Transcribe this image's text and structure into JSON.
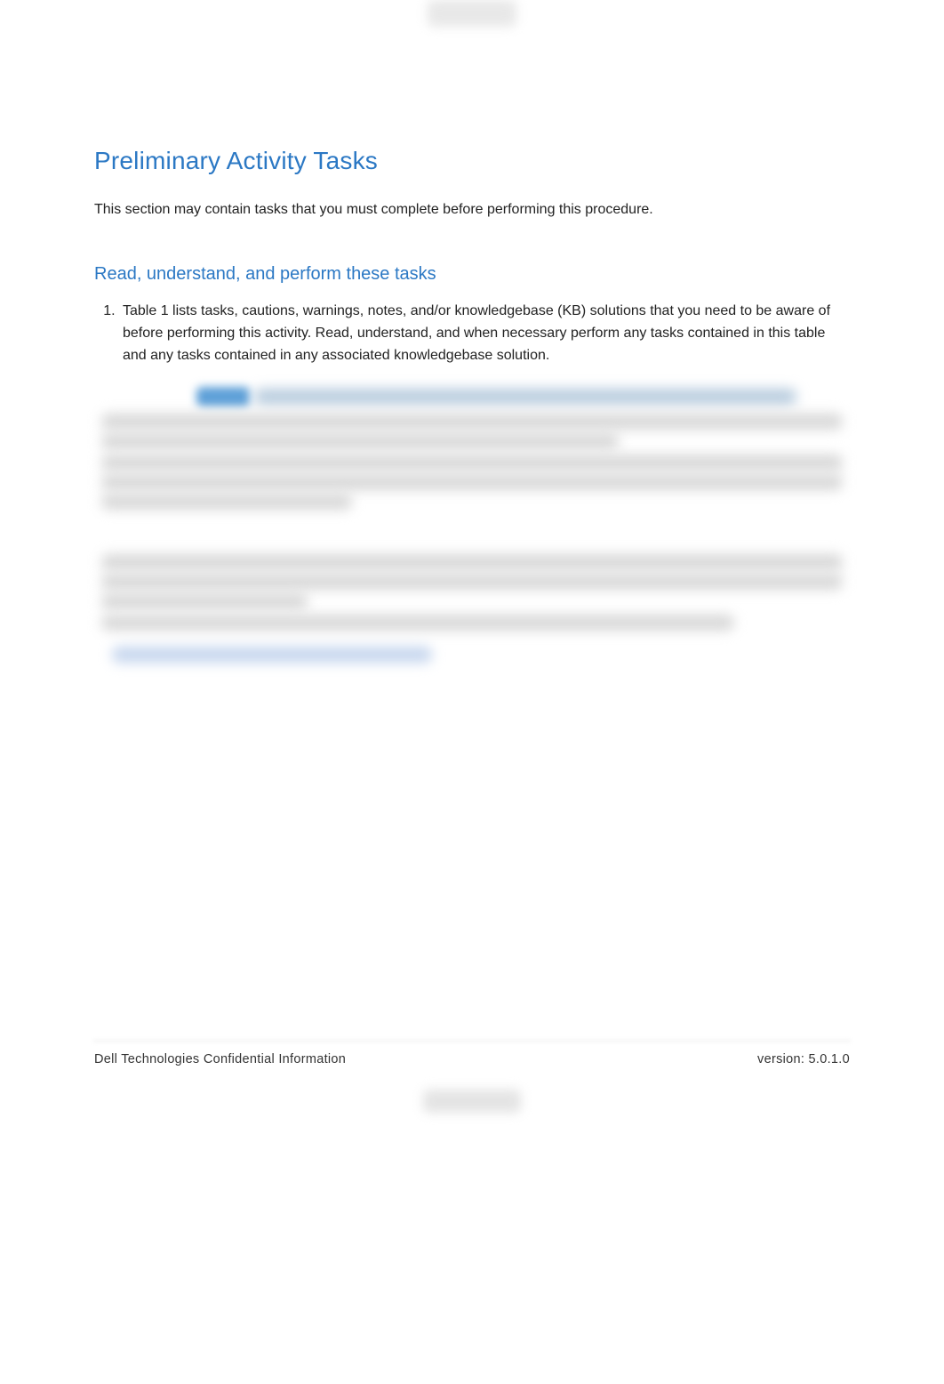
{
  "section": {
    "title": "Preliminary Activity Tasks",
    "intro": "This section may contain tasks that you must complete before performing this procedure.",
    "subsection_title": "Read, understand, and perform these tasks",
    "list_item_1": "Table 1 lists tasks, cautions, warnings, notes, and/or knowledgebase (KB) solutions that you need to be aware of before performing this activity.  Read, understand, and when necessary perform any tasks contained in this table and any tasks contained in any associated knowledgebase solution."
  },
  "footer": {
    "left": "Dell Technologies Confidential Information",
    "right_label": "version: ",
    "version": "5.0.1.0"
  }
}
